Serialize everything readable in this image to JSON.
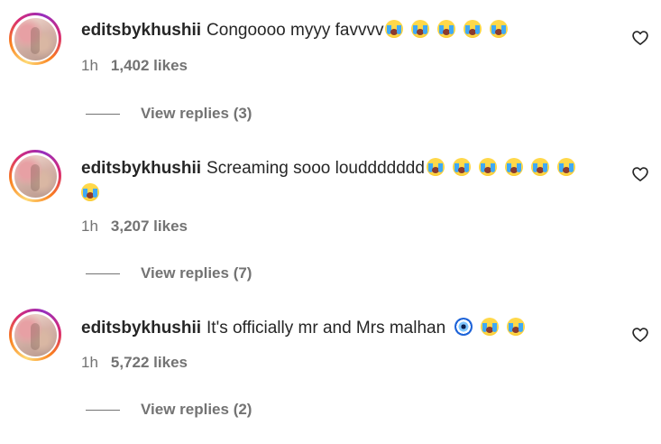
{
  "comments": [
    {
      "username": "editsbykhushii",
      "text": "Congoooo myyy favvvv",
      "time": "1h",
      "likes": "1,402 likes",
      "replies": "View replies (3)",
      "emojis_after_text": [
        "crying-face-emoji",
        "crying-face-emoji",
        "crying-face-emoji",
        "crying-face-emoji",
        "crying-face-emoji"
      ]
    },
    {
      "username": "editsbykhushii",
      "text": "Screaming sooo louddddddd",
      "time": "1h",
      "likes": "3,207 likes",
      "replies": "View replies (7)",
      "emojis_after_text": [
        "crying-face-emoji",
        "crying-face-emoji",
        "crying-face-emoji",
        "crying-face-emoji",
        "crying-face-emoji",
        "crying-face-emoji",
        "crying-face-emoji"
      ]
    },
    {
      "username": "editsbykhushii",
      "text": "It's officially mr and Mrs malhan",
      "time": "1h",
      "likes": "5,722 likes",
      "replies": "View replies (2)",
      "emojis_after_text": [
        "nazar-amulet-emoji",
        "crying-face-emoji",
        "crying-face-emoji"
      ]
    }
  ],
  "colors": {
    "text": "#262626",
    "secondary": "#737373",
    "ring_start": "#feda75",
    "ring_end": "#962fbf"
  },
  "icons": {
    "like": "heart-outline-icon"
  }
}
